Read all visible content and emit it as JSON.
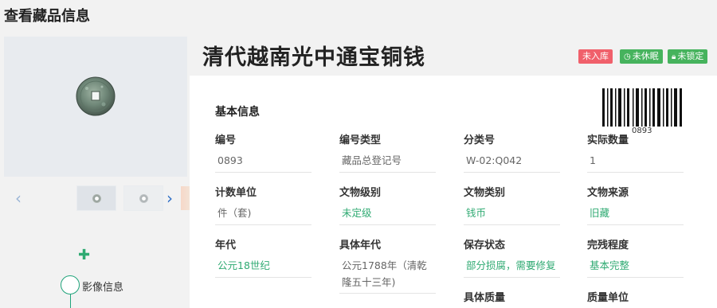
{
  "page": {
    "title": "查看藏品信息"
  },
  "gallery": {
    "prev_icon": "chevron-left-icon",
    "next_icon": "chevron-right-icon",
    "add_icon": "plus-icon"
  },
  "timeline": {
    "label": "影像信息"
  },
  "object": {
    "name": "清代越南光中通宝铜钱"
  },
  "badges": [
    {
      "label": "未入库",
      "color": "#f0606b",
      "icon": ""
    },
    {
      "label": "未休眠",
      "color": "#46b35d",
      "icon": "clock-icon"
    },
    {
      "label": "未锁定",
      "color": "#46b35d",
      "icon": "lock-icon"
    }
  ],
  "basic_info": {
    "title": "基本信息",
    "barcode_number": "0893",
    "fields": [
      {
        "label": "编号",
        "value": "0893",
        "color": "gray"
      },
      {
        "label": "编号类型",
        "value": "藏品总登记号",
        "color": "gray"
      },
      {
        "label": "分类号",
        "value": "W-02:Q042",
        "color": "gray"
      },
      {
        "label": "实际数量",
        "value": "1",
        "color": "gray"
      },
      {
        "label": "计数单位",
        "value": "件（套)",
        "color": "gray"
      },
      {
        "label": "文物级别",
        "value": "未定级",
        "color": "green"
      },
      {
        "label": "文物类别",
        "value": "钱币",
        "color": "green"
      },
      {
        "label": "文物来源",
        "value": "旧藏",
        "color": "green"
      },
      {
        "label": "年代",
        "value": "公元18世纪",
        "color": "green"
      },
      {
        "label": "具体年代",
        "value": "公元1788年（清乾隆五十三年)",
        "color": "gray"
      },
      {
        "label": "保存状态",
        "value": "部分损腐，需要修复",
        "color": "green"
      },
      {
        "label": "完残程度",
        "value": "基本完整",
        "color": "green"
      },
      {
        "label": "具体质量",
        "value": "",
        "color": "gray"
      },
      {
        "label": "质量单位",
        "value": "",
        "color": "gray"
      }
    ]
  },
  "colors": {
    "accent_green": "#2faa72",
    "badge_red": "#f0606b",
    "badge_green": "#46b35d"
  }
}
